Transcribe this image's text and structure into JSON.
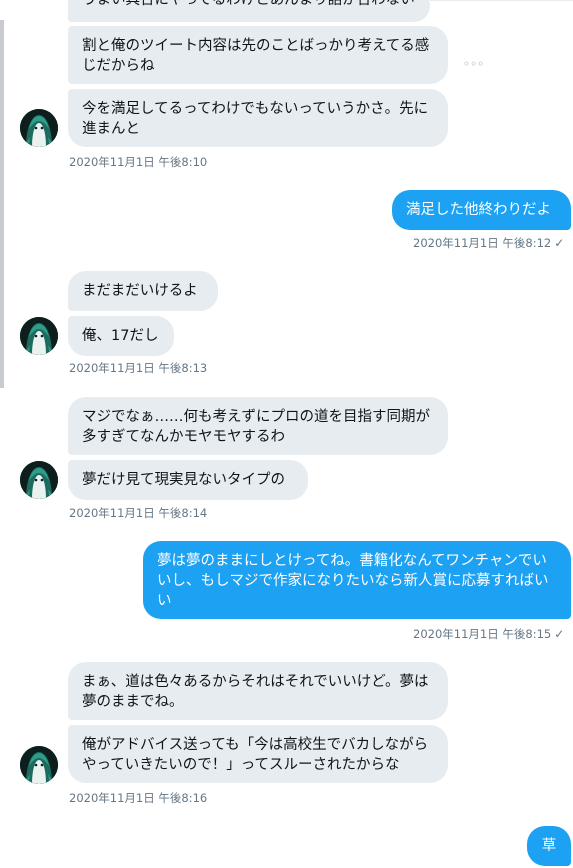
{
  "conversation": {
    "groups": [
      {
        "messages": [
          "うまい具合にやってるわけとあんまり話か合わない",
          "割と俺のツイート内容は先のことばっかり考えてる感じだからね",
          "今を満足してるってわけでもないっていうかさ。先に進まんと"
        ],
        "timestamp": "2020年11月1日 午後8:10"
      },
      {
        "sent": "満足した他終わりだよ",
        "timestamp": "2020年11月1日 午後8:12"
      },
      {
        "messages": [
          "まだまだいけるよ",
          "俺、17だし"
        ],
        "timestamp": "2020年11月1日 午後8:13"
      },
      {
        "messages": [
          "マジでなぁ……何も考えずにプロの道を目指す同期が多すぎてなんかモヤモヤするわ",
          "夢だけ見て現実見ないタイプの"
        ],
        "timestamp": "2020年11月1日 午後8:14"
      },
      {
        "sent": "夢は夢のままにしとけってね。書籍化なんてワンチャンでいいし、もしマジで作家になりたいなら新人賞に応募すればいい",
        "timestamp": "2020年11月1日 午後8:15"
      },
      {
        "messages": [
          "まぁ、道は色々あるからそれはそれでいいけど。夢は夢のままでね。",
          "俺がアドバイス送っても「今は高校生でバカしながらやっていきたいので！」ってスルーされたからな"
        ],
        "timestamp": "2020年11月1日 午後8:16"
      },
      {
        "sent": "草"
      }
    ]
  },
  "icons": {
    "more": "more-options-icon",
    "check": "sent-check-icon",
    "avatar": "avatar-anime-character"
  },
  "glyphs": {
    "more": "◦◦◦",
    "check": "✓"
  },
  "colors": {
    "received_bubble": "#e6ecf0",
    "sent_bubble": "#1da1f2",
    "timestamp": "#657786"
  }
}
